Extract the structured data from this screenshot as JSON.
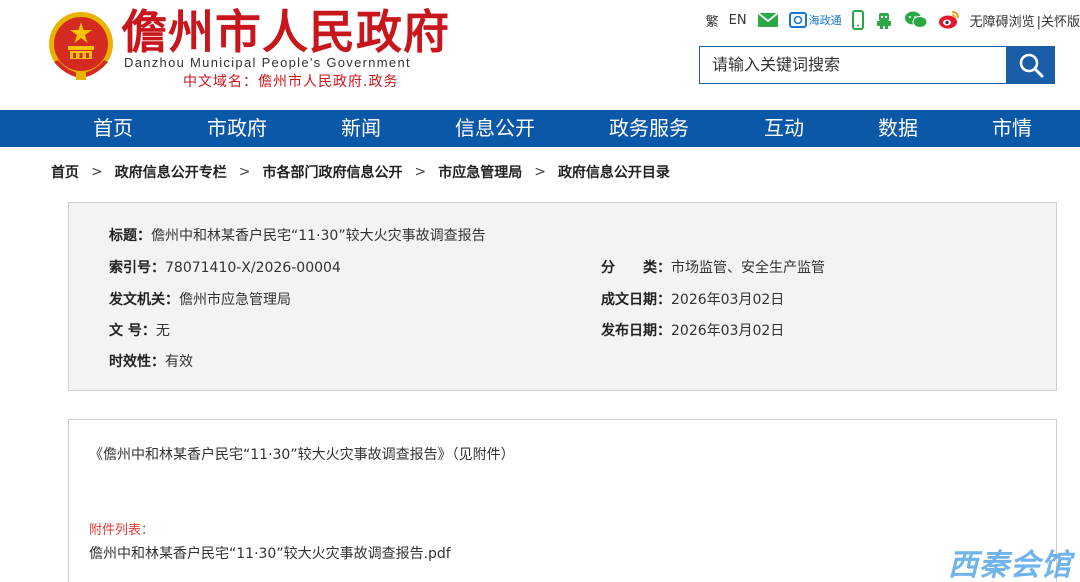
{
  "header": {
    "title": "儋州市人民政府",
    "subtitle_en": "Danzhou Municipal People's Government",
    "domain": "中文域名：儋州市人民政府.政务"
  },
  "toolbar": {
    "traditional": "繁",
    "english": "EN",
    "haizhengtong": "海政通",
    "accessibility": "无障碍浏览",
    "care": "|关怀版",
    "icons": [
      "mail-icon",
      "haizhengtong-icon",
      "mobile-icon",
      "robot-icon",
      "wechat-icon",
      "weibo-icon"
    ]
  },
  "search": {
    "placeholder": "请输入关键词搜索"
  },
  "nav": {
    "items": [
      "首页",
      "市政府",
      "新闻",
      "信息公开",
      "政务服务",
      "互动",
      "数据",
      "市情"
    ]
  },
  "breadcrumb": [
    "首页",
    "政府信息公开专栏",
    "市各部门政府信息公开",
    "市应急管理局",
    "政府信息公开目录"
  ],
  "info": {
    "title_label": "标题：",
    "title_value": "儋州中和林某香户民宅“11·30”较大火灾事故调查报告",
    "index_label": "索引号：",
    "index_value": "78071410-X/2026-00004",
    "category_label": "分　　类：",
    "category_value": "市场监管、安全生产监管",
    "issuer_label": "发文机关：",
    "issuer_value": "儋州市应急管理局",
    "created_label": "成文日期：",
    "created_value": "2026年03月02日",
    "docno_label": "文 号：",
    "docno_value": "无",
    "published_label": "发布日期：",
    "published_value": "2026年03月02日",
    "validity_label": "时效性：",
    "validity_value": "有效"
  },
  "content": {
    "text": "《儋州中和林某香户民宅“11·30”较大火灾事故调查报告》（见附件）",
    "attachments_title": "附件列表：",
    "attachment_file": "儋州中和林某香户民宅“11·30”较大火灾事故调查报告.pdf"
  },
  "watermark": "西秦会馆",
  "colors": {
    "brand_red": "#c8161d",
    "nav_blue": "#0b57a8",
    "search_blue": "#1b5ea8",
    "attachment_red": "#e53935"
  }
}
